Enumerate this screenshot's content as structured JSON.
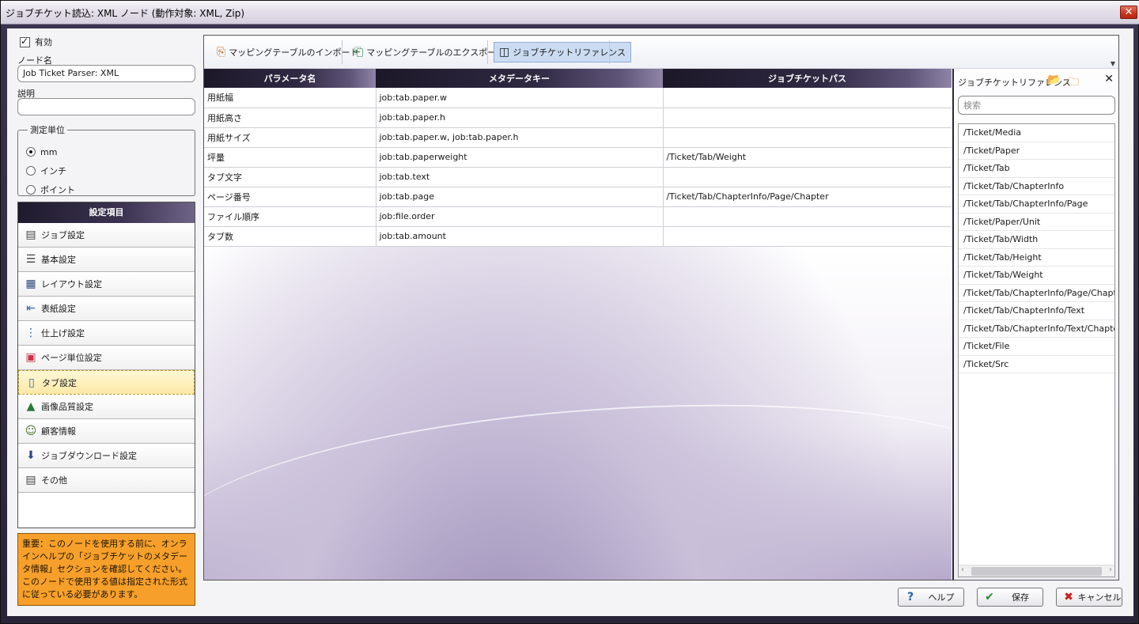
{
  "window": {
    "title": "ジョブチケット読込: XML ノード (動作対象: XML, Zip)",
    "close_label": "✕"
  },
  "left": {
    "enabled_label": "有効",
    "enabled_checked": true,
    "node_name_label": "ノード名",
    "node_name_value": "Job Ticket Parser: XML",
    "description_label": "説明",
    "description_value": "",
    "units": {
      "legend": "測定単位",
      "options": [
        "mm",
        "インチ",
        "ポイント"
      ],
      "selected": "mm"
    },
    "settings": {
      "header": "設定項目",
      "items": [
        {
          "label": "ジョブ設定",
          "icon": "document-icon"
        },
        {
          "label": "基本設定",
          "icon": "list-icon"
        },
        {
          "label": "レイアウト設定",
          "icon": "layout-icon"
        },
        {
          "label": "表紙設定",
          "icon": "cover-icon"
        },
        {
          "label": "仕上げ設定",
          "icon": "finishing-icon"
        },
        {
          "label": "ページ単位設定",
          "icon": "pages-icon"
        },
        {
          "label": "タブ設定",
          "icon": "tab-icon",
          "selected": true
        },
        {
          "label": "画像品質設定",
          "icon": "image-icon"
        },
        {
          "label": "顧客情報",
          "icon": "customer-icon"
        },
        {
          "label": "ジョブダウンロード設定",
          "icon": "download-icon"
        },
        {
          "label": "その他",
          "icon": "other-icon"
        }
      ]
    },
    "note": "重要：このノードを使用する前に、オンラインヘルプの「ジョブチケットのメタデータ情報」セクションを確認してください。このノードで使用する値は指定された形式に従っている必要があります。"
  },
  "toolbar": {
    "import_label": "マッピングテーブルのインポート",
    "export_label": "マッピングテーブルのエクスポート",
    "reference_label": "ジョブチケットリファレンス"
  },
  "grid": {
    "columns": [
      "パラメータ名",
      "メタデータキー",
      "ジョブチケットパス"
    ],
    "rows": [
      [
        "用紙幅",
        "job:tab.paper.w",
        ""
      ],
      [
        "用紙高さ",
        "job:tab.paper.h",
        ""
      ],
      [
        "用紙サイズ",
        "job:tab.paper.w, job:tab.paper.h",
        ""
      ],
      [
        "坪量",
        "job:tab.paperweight",
        "/Ticket/Tab/Weight"
      ],
      [
        "タブ文字",
        "job:tab.text",
        ""
      ],
      [
        "ページ番号",
        "job:tab.page",
        "/Ticket/Tab/ChapterInfo/Page/Chapter"
      ],
      [
        "ファイル順序",
        "job:file.order",
        ""
      ],
      [
        "タブ数",
        "job:tab.amount",
        ""
      ]
    ]
  },
  "reference": {
    "title": "ジョブチケットリファレンス",
    "search_placeholder": "検索",
    "items": [
      "/Ticket/Media",
      "/Ticket/Paper",
      "/Ticket/Tab",
      "/Ticket/Tab/ChapterInfo",
      "/Ticket/Tab/ChapterInfo/Page",
      "/Ticket/Paper/Unit",
      "/Ticket/Tab/Width",
      "/Ticket/Tab/Height",
      "/Ticket/Tab/Weight",
      "/Ticket/Tab/ChapterInfo/Page/Chapter",
      "/Ticket/Tab/ChapterInfo/Text",
      "/Ticket/Tab/ChapterInfo/Text/Chapter",
      "/Ticket/File",
      "/Ticket/Src"
    ]
  },
  "buttons": {
    "help_label": "ヘルプ",
    "save_label": "保存",
    "cancel_label": "キャンセル"
  },
  "colors": {
    "accent_dark": "#2b2538",
    "note_bg": "#f6a02b",
    "selected_item": "#fde9a6",
    "active_tool": "#cbdcf2"
  }
}
